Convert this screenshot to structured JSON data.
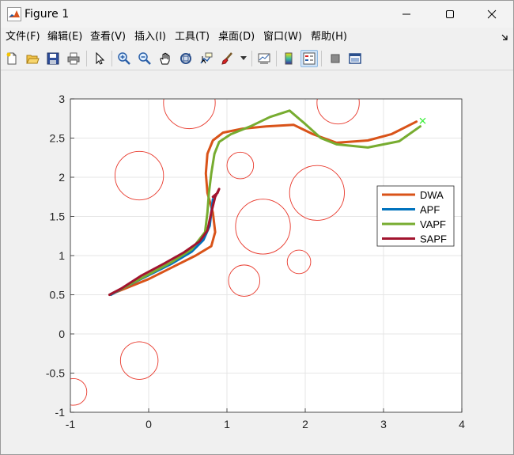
{
  "window": {
    "title": "Figure 1",
    "minimize_icon": "minimize-icon",
    "maximize_icon": "maximize-icon",
    "close_icon": "close-icon"
  },
  "menu": {
    "items": [
      {
        "label": "文件(F)"
      },
      {
        "label": "编辑(E)"
      },
      {
        "label": "查看(V)"
      },
      {
        "label": "插入(I)"
      },
      {
        "label": "工具(T)"
      },
      {
        "label": "桌面(D)"
      },
      {
        "label": "窗口(W)"
      },
      {
        "label": "帮助(H)"
      }
    ]
  },
  "toolbar": {
    "buttons": [
      "new-figure-icon",
      "open-file-icon",
      "save-icon",
      "print-icon",
      "pointer-icon",
      "zoom-in-icon",
      "zoom-out-icon",
      "pan-hand-icon",
      "rotate-3d-icon",
      "data-cursor-icon",
      "brush-icon",
      "link-plot-icon",
      "colorbar-icon",
      "legend-icon",
      "hide-plot-tools-icon",
      "show-plot-tools-icon"
    ]
  },
  "colors": {
    "obstacle": "#e8372a",
    "DWA": "#d95319",
    "APF": "#0072bd",
    "VAPF": "#77ac30",
    "SAPF": "#a2142f",
    "goal": "#33ee33",
    "grid": "#e6e6e6"
  },
  "chart_data": {
    "type": "line",
    "xlim": [
      -1,
      4
    ],
    "ylim": [
      -1,
      3
    ],
    "xticks": [
      -1,
      0,
      1,
      2,
      3,
      4
    ],
    "yticks": [
      -1,
      -0.5,
      0,
      0.5,
      1,
      1.5,
      2,
      2.5,
      3
    ],
    "xtick_labels": [
      "-1",
      "0",
      "1",
      "2",
      "3",
      "4"
    ],
    "ytick_labels": [
      "-1",
      "-0.5",
      "0",
      "0.5",
      "1",
      "1.5",
      "2",
      "2.5",
      "3"
    ],
    "grid": true,
    "legend": {
      "position": "right",
      "entries": [
        "DWA",
        "APF",
        "VAPF",
        "SAPF"
      ]
    },
    "obstacles": [
      {
        "cx": 0.52,
        "cy": 2.95,
        "r": 0.33
      },
      {
        "cx": 2.42,
        "cy": 2.95,
        "r": 0.27
      },
      {
        "cx": -0.12,
        "cy": 2.02,
        "r": 0.31
      },
      {
        "cx": 1.17,
        "cy": 2.15,
        "r": 0.17
      },
      {
        "cx": 2.15,
        "cy": 1.8,
        "r": 0.35
      },
      {
        "cx": 1.46,
        "cy": 1.37,
        "r": 0.35
      },
      {
        "cx": 1.92,
        "cy": 0.92,
        "r": 0.15
      },
      {
        "cx": 1.22,
        "cy": 0.68,
        "r": 0.2
      },
      {
        "cx": -0.12,
        "cy": -0.34,
        "r": 0.24
      },
      {
        "cx": -0.96,
        "cy": -0.74,
        "r": 0.17
      }
    ],
    "goal": {
      "x": 3.5,
      "y": 2.72
    },
    "series": [
      {
        "name": "DWA",
        "x": [
          -0.5,
          -0.3,
          0.0,
          0.3,
          0.6,
          0.8,
          0.85,
          0.82,
          0.75,
          0.73,
          0.75,
          0.82,
          0.95,
          1.2,
          1.5,
          1.85,
          2.1,
          2.4,
          2.8,
          3.1,
          3.42
        ],
        "y": [
          0.5,
          0.58,
          0.7,
          0.85,
          1.0,
          1.12,
          1.3,
          1.55,
          1.8,
          2.05,
          2.3,
          2.47,
          2.57,
          2.62,
          2.65,
          2.67,
          2.55,
          2.44,
          2.47,
          2.55,
          2.71
        ]
      },
      {
        "name": "APF",
        "x": [
          -0.48,
          -0.3,
          0.0,
          0.3,
          0.55,
          0.7,
          0.78,
          0.8,
          0.82
        ],
        "y": [
          0.5,
          0.6,
          0.75,
          0.9,
          1.05,
          1.2,
          1.38,
          1.55,
          1.72
        ]
      },
      {
        "name": "VAPF",
        "x": [
          -0.5,
          -0.3,
          0.0,
          0.3,
          0.55,
          0.72,
          0.75,
          0.77,
          0.8,
          0.84,
          0.9,
          1.05,
          1.3,
          1.55,
          1.8,
          2.0,
          2.2,
          2.4,
          2.8,
          3.2,
          3.47
        ],
        "y": [
          0.5,
          0.6,
          0.76,
          0.92,
          1.08,
          1.3,
          1.55,
          1.8,
          2.05,
          2.3,
          2.45,
          2.55,
          2.65,
          2.77,
          2.85,
          2.68,
          2.5,
          2.42,
          2.38,
          2.46,
          2.65
        ]
      },
      {
        "name": "SAPF",
        "x": [
          -0.5,
          -0.35,
          -0.1,
          0.2,
          0.45,
          0.65,
          0.75,
          0.8,
          0.85,
          0.9,
          0.88,
          0.82
        ],
        "y": [
          0.5,
          0.58,
          0.74,
          0.9,
          1.04,
          1.18,
          1.32,
          1.55,
          1.75,
          1.85,
          1.8,
          1.75
        ]
      }
    ]
  }
}
